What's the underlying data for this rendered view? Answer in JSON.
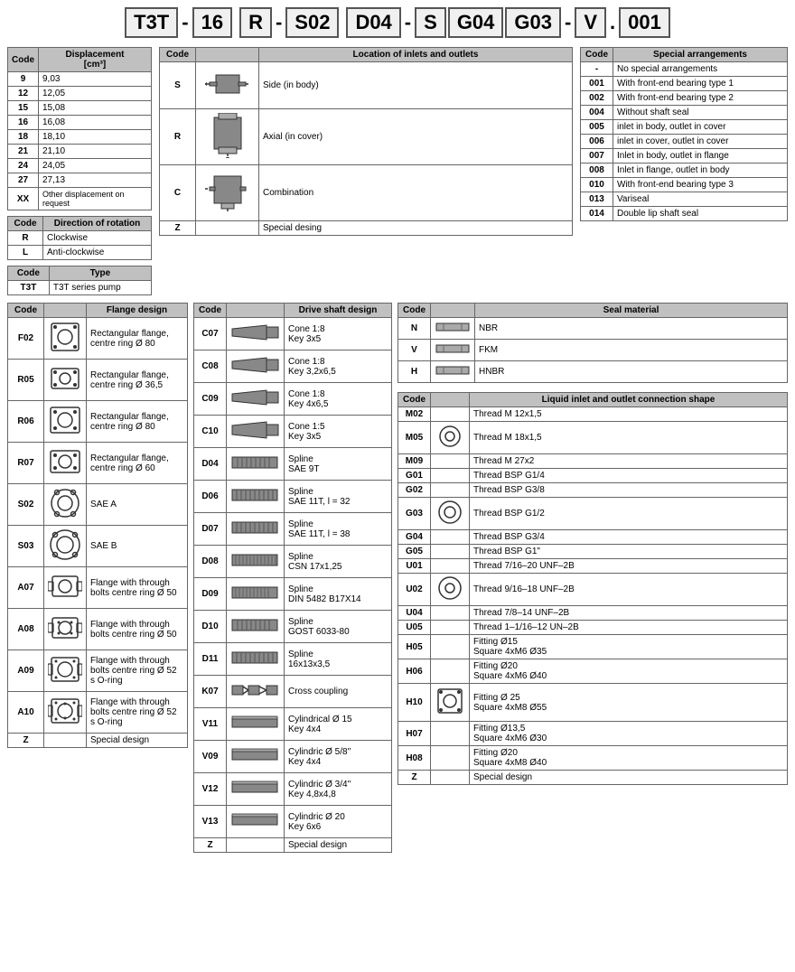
{
  "partNumber": {
    "segments": [
      "T3T",
      "16",
      "R",
      "S02",
      "D04",
      "S",
      "G04",
      "G03",
      "V",
      "001"
    ],
    "separators": [
      "-",
      "-",
      "-",
      "",
      "-",
      "",
      "",
      "-",
      ".",
      ""
    ]
  },
  "displacementTable": {
    "title": "Displacement [cm³]",
    "headers": [
      "Code",
      "Displacement [cm³]"
    ],
    "rows": [
      {
        "code": "9",
        "value": "9,03"
      },
      {
        "code": "12",
        "value": "12,05"
      },
      {
        "code": "15",
        "value": "15,08"
      },
      {
        "code": "16",
        "value": "16,08"
      },
      {
        "code": "18",
        "value": "18,10"
      },
      {
        "code": "21",
        "value": "21,10"
      },
      {
        "code": "24",
        "value": "24,05"
      },
      {
        "code": "27",
        "value": "27,13"
      },
      {
        "code": "XX",
        "value": "Other displacement on request"
      }
    ]
  },
  "rotationTable": {
    "headers": [
      "Code",
      "Direction of rotation"
    ],
    "rows": [
      {
        "code": "R",
        "value": "Clockwise"
      },
      {
        "code": "L",
        "value": "Anti-clockwise"
      }
    ]
  },
  "typeTable": {
    "headers": [
      "Code",
      "Type"
    ],
    "rows": [
      {
        "code": "T3T",
        "value": "T3T series pump"
      }
    ]
  },
  "locationTable": {
    "headers": [
      "Code",
      "Location of inlets and outlets"
    ],
    "rows": [
      {
        "code": "S",
        "label": "Side (in body)"
      },
      {
        "code": "R",
        "label": "Axial (in cover)"
      },
      {
        "code": "C",
        "label": "Combination"
      },
      {
        "code": "Z",
        "label": "Special desing"
      }
    ]
  },
  "specialTable": {
    "headers": [
      "Code",
      "Special arrangements"
    ],
    "rows": [
      {
        "code": "-",
        "value": "No special arrangements"
      },
      {
        "code": "001",
        "value": "With front-end bearing type 1"
      },
      {
        "code": "002",
        "value": "With front-end bearing type 2"
      },
      {
        "code": "004",
        "value": "Without shaft seal"
      },
      {
        "code": "005",
        "value": "inlet in body, outlet in cover"
      },
      {
        "code": "006",
        "value": "inlet in cover, outlet in cover"
      },
      {
        "code": "007",
        "value": "Inlet in body, outlet in flange"
      },
      {
        "code": "008",
        "value": "Inlet in flange, outlet in body"
      },
      {
        "code": "010",
        "value": "With front-end bearing type 3"
      },
      {
        "code": "013",
        "value": "Variseal"
      },
      {
        "code": "014",
        "value": "Double lip shaft seal"
      }
    ]
  },
  "flangeTable": {
    "headers": [
      "Code",
      "",
      "Flange design"
    ],
    "rows": [
      {
        "code": "F02",
        "label": "Rectangular flange, centre ring Ø 80"
      },
      {
        "code": "R05",
        "label": "Rectangular flange, centre ring Ø 36,5"
      },
      {
        "code": "R06",
        "label": "Rectangular flange, centre ring Ø 80"
      },
      {
        "code": "R07",
        "label": "Rectangular flange, centre ring Ø 60"
      },
      {
        "code": "S02",
        "label": "SAE A"
      },
      {
        "code": "S03",
        "label": "SAE B"
      },
      {
        "code": "A07",
        "label": "Flange with through bolts centre ring Ø 50"
      },
      {
        "code": "A08",
        "label": "Flange with through bolts centre ring Ø 50"
      },
      {
        "code": "A09",
        "label": "Flange with through bolts centre ring Ø 52 s O-ring"
      },
      {
        "code": "A10",
        "label": "Flange with through bolts centre ring Ø 52 s O-ring"
      },
      {
        "code": "Z",
        "label": "Special design"
      }
    ]
  },
  "driveTable": {
    "headers": [
      "Code",
      "",
      "Drive shaft design"
    ],
    "rows": [
      {
        "code": "C07",
        "label": "Cone 1:8\nKey 3x5"
      },
      {
        "code": "C08",
        "label": "Cone 1:8\nKey 3,2x6,5"
      },
      {
        "code": "C09",
        "label": "Cone 1:8\nKey 4x6,5"
      },
      {
        "code": "C10",
        "label": "Cone 1:5\nKey 3x5"
      },
      {
        "code": "D04",
        "label": "Spline\nSAE 9T"
      },
      {
        "code": "D06",
        "label": "Spline\nSAE 11T, l = 32"
      },
      {
        "code": "D07",
        "label": "Spline\nSAE 11T, l = 38"
      },
      {
        "code": "D08",
        "label": "Spline\nCSN 17x1,25"
      },
      {
        "code": "D09",
        "label": "Spline\nDIN 5482 B17X14"
      },
      {
        "code": "D10",
        "label": "Spline\nGOST 6033-80"
      },
      {
        "code": "D11",
        "label": "Spline\n16x13x3,5"
      },
      {
        "code": "K07",
        "label": "Cross coupling"
      },
      {
        "code": "V11",
        "label": "Cylindrical Ø 15\nKey 4x4"
      },
      {
        "code": "V09",
        "label": "Cylindric Ø 5/8''\nKey 4x4"
      },
      {
        "code": "V12",
        "label": "Cylindric Ø 3/4''\nKey 4,8x4,8"
      },
      {
        "code": "V13",
        "label": "Cylindric Ø 20\nKey 6x6"
      },
      {
        "code": "Z",
        "label": "Special design"
      }
    ]
  },
  "sealTable": {
    "headers": [
      "Code",
      "",
      "Seal material"
    ],
    "rows": [
      {
        "code": "N",
        "label": "NBR"
      },
      {
        "code": "V",
        "label": "FKM"
      },
      {
        "code": "H",
        "label": "HNBR"
      }
    ]
  },
  "connectionTable": {
    "headers": [
      "Code",
      "",
      "Liquid inlet and outlet connection shape"
    ],
    "rows": [
      {
        "code": "M02",
        "label": "Thread M 12x1,5"
      },
      {
        "code": "M05",
        "label": "Thread M 18x1,5"
      },
      {
        "code": "M09",
        "label": "Thread M 27x2"
      },
      {
        "code": "G01",
        "label": "Thread BSP G1/4"
      },
      {
        "code": "G02",
        "label": "Thread BSP G3/8"
      },
      {
        "code": "G03",
        "label": "Thread BSP G1/2"
      },
      {
        "code": "G04",
        "label": "Thread BSP G3/4"
      },
      {
        "code": "G05",
        "label": "Thread BSP G1\""
      },
      {
        "code": "U01",
        "label": "Thread 7/16–20 UNF–2B"
      },
      {
        "code": "U02",
        "label": "Thread 9/16–18 UNF–2B"
      },
      {
        "code": "U04",
        "label": "Thread 7/8–14 UNF–2B"
      },
      {
        "code": "U05",
        "label": "Thread 1–1/16–12 UN–2B"
      },
      {
        "code": "H05",
        "label": "Fitting Ø15\nSquare 4xM6 Ø35"
      },
      {
        "code": "H06",
        "label": "Fitting Ø20\nSquare 4xM6 Ø40"
      },
      {
        "code": "H10",
        "label": "Fitting Ø 25\nSquare 4xM8 Ø55"
      },
      {
        "code": "H07",
        "label": "Fitting Ø13,5\nSquare 4xM6 Ø30"
      },
      {
        "code": "H08",
        "label": "Fitting Ø20\nSquare 4xM8 Ø40"
      },
      {
        "code": "Z",
        "label": "Special design"
      }
    ]
  }
}
